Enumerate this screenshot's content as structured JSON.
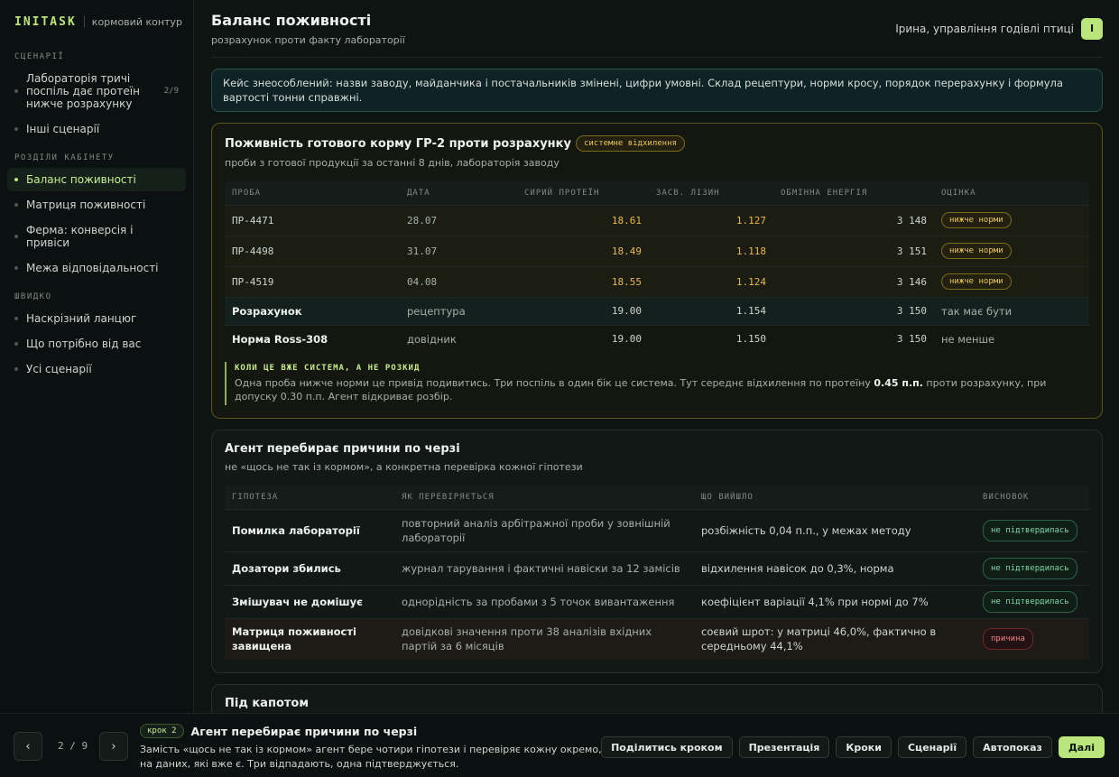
{
  "brand": {
    "logo": "INITASK",
    "subtitle": "кормовий контур"
  },
  "sidebar": {
    "scenarios_title": "СЦЕНАРІЇ",
    "scenarios": [
      {
        "label": "Лабораторія тричі поспіль дає протеїн нижче розрахунку",
        "count": "2/9"
      },
      {
        "label": "Інші сценарії"
      }
    ],
    "sections_title": "РОЗДІЛИ КАБІНЕТУ",
    "sections": [
      {
        "label": "Баланс поживності"
      },
      {
        "label": "Матриця поживності"
      },
      {
        "label": "Ферма: конверсія і привіси"
      },
      {
        "label": "Межа відповідальності"
      }
    ],
    "quick_title": "ШВИДКО",
    "quick": [
      {
        "label": "Наскрізний ланцюг"
      },
      {
        "label": "Що потрібно від вас"
      },
      {
        "label": "Усі сценарії"
      }
    ]
  },
  "header": {
    "title": "Баланс поживності",
    "subtitle": "розрахунок проти факту лабораторії",
    "user_name": "Ірина, управління годівлі птиці",
    "avatar": "І"
  },
  "notice": "Кейс знеособлений: назви заводу, майданчика і постачальників змінені, цифри умовні. Склад рецептури, норми кросу, порядок перерахунку і формула вартості тонни справжні.",
  "card1": {
    "title": "Поживність готового корму ГР-2 проти розрахунку",
    "badge": "системне відхилення",
    "subtitle": "проби з готової продукції за останні 8 днів, лабораторія заводу",
    "columns": [
      "ПРОБА",
      "ДАТА",
      "СИРИЙ ПРОТЕЇН",
      "ЗАСВ. ЛІЗИН",
      "ОБМІННА ЕНЕРГІЯ",
      "ОЦІНКА"
    ],
    "rows": [
      {
        "sample": "ПР-4471",
        "date": "28.07",
        "protein": "18.61",
        "lysine": "1.127",
        "energy": "3 148",
        "grade": "нижче норми"
      },
      {
        "sample": "ПР-4498",
        "date": "31.07",
        "protein": "18.49",
        "lysine": "1.118",
        "energy": "3 151",
        "grade": "нижче норми"
      },
      {
        "sample": "ПР-4519",
        "date": "04.08",
        "protein": "18.55",
        "lysine": "1.124",
        "energy": "3 146",
        "grade": "нижче норми"
      },
      {
        "sample": "Розрахунок",
        "date": "рецептура",
        "protein": "19.00",
        "lysine": "1.154",
        "energy": "3 150",
        "grade": "так має бути"
      },
      {
        "sample": "Норма Ross-308",
        "date": "довідник",
        "protein": "19.00",
        "lysine": "1.150",
        "energy": "3 150",
        "grade": "не менше"
      }
    ],
    "callout_title": "КОЛИ ЦЕ ВЖЕ СИСТЕМА, А НЕ РОЗКИД",
    "callout_before": "Одна проба нижче норми це привід подивитись. Три поспіль в один бік це система. Тут середнє відхилення по протеїну ",
    "callout_bold": "0.45 п.п.",
    "callout_after": " проти розрахунку, при допуску 0.30 п.п. Агент відкриває розбір."
  },
  "card2": {
    "title": "Агент перебирає причини по черзі",
    "subtitle": "не «щось не так із кормом», а конкретна перевірка кожної гіпотези",
    "columns": [
      "ГІПОТЕЗА",
      "ЯК ПЕРЕВІРЯЄТЬСЯ",
      "ЩО ВИЙШЛО",
      "ВИСНОВОК"
    ],
    "rows": [
      {
        "hypothesis": "Помилка лабораторії",
        "method": "повторний аналіз арбітражної проби у зовнішній лабораторії",
        "result": "розбіжність 0,04 п.п., у межах методу",
        "verdict": "не підтвердилась"
      },
      {
        "hypothesis": "Дозатори збились",
        "method": "журнал тарування і фактичні навіски за 12 замісів",
        "result": "відхилення навісок до 0,3%, норма",
        "verdict": "не підтвердилась"
      },
      {
        "hypothesis": "Змішувач не домішує",
        "method": "однорідність за пробами з 5 точок вивантаження",
        "result": "коефіцієнт варіації 4,1% при нормі до 7%",
        "verdict": "не підтвердилась"
      },
      {
        "hypothesis": "Матриця поживності завищена",
        "method": "довідкові значення проти 38 аналізів вхідних партій за 6 місяців",
        "result": "соєвий шрот: у матриці 46,0%, фактично в середньому 44,1%",
        "verdict": "причина"
      }
    ]
  },
  "card3": {
    "title": "Під капотом"
  },
  "footer": {
    "prev": "‹",
    "next": "›",
    "pager": "2 / 9",
    "step_badge": "крок 2",
    "step_title": "Агент перебирає причини по черзі",
    "step_desc": "Замість «щось не так із кормом» агент бере чотири гіпотези і перевіряє кожну окремо, на даних, які вже є. Три відпадають, одна підтверджується.",
    "actions": [
      "Поділитись кроком",
      "Презентація",
      "Кроки",
      "Сценарії",
      "Автопоказ",
      "Далі"
    ]
  },
  "colors": {
    "accent": "#b9e57a",
    "amber": "#e9c650",
    "green": "#7fd7a8",
    "red": "#f08080"
  }
}
